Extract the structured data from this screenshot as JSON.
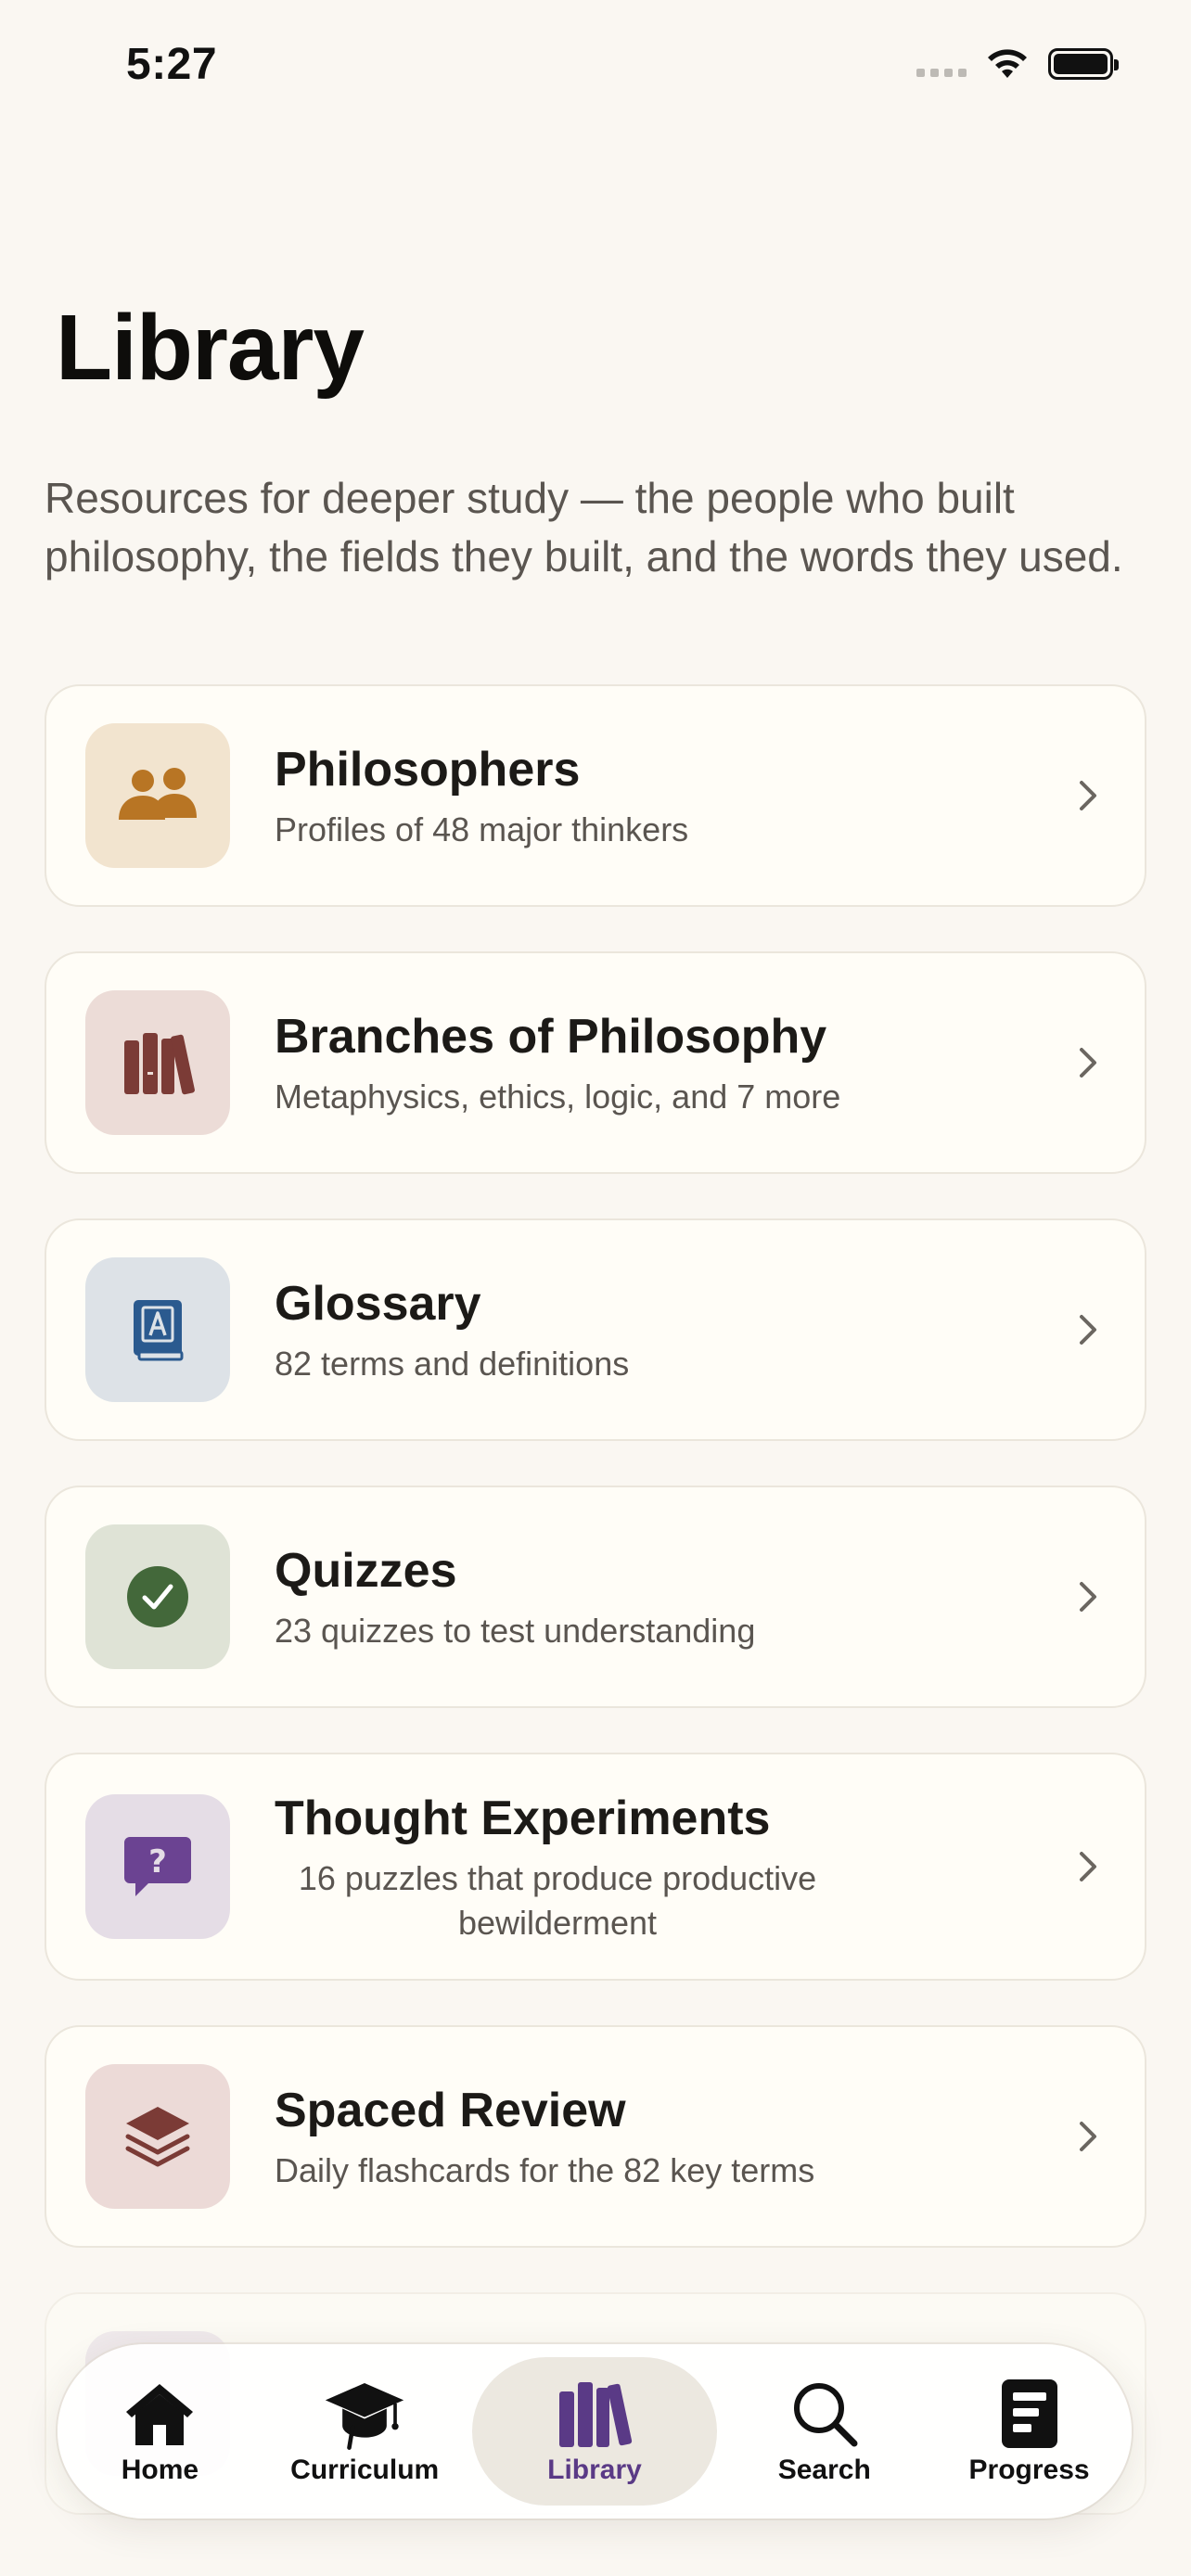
{
  "status": {
    "time": "5:27"
  },
  "page": {
    "title": "Library",
    "subtitle": "Resources for deeper study — the people who built philosophy, the fields they built, and the words they used."
  },
  "cards": [
    {
      "title": "Philosophers",
      "description": "Profiles of 48 major thinkers",
      "icon": "people-icon",
      "icon_bg": "#f2e4cf",
      "icon_color": "#b87524"
    },
    {
      "title": "Branches of Philosophy",
      "description": "Metaphysics, ethics, logic, and 7 more",
      "icon": "books-icon",
      "icon_bg": "#ecdcd7",
      "icon_color": "#7b3b36"
    },
    {
      "title": "Glossary",
      "description": "82 terms and definitions",
      "icon": "dictionary-icon",
      "icon_bg": "#dde2e7",
      "icon_color": "#2b5a8f"
    },
    {
      "title": "Quizzes",
      "description": "23 quizzes to test understanding",
      "icon": "checkmark-icon",
      "icon_bg": "#dfe3d6",
      "icon_color": "#43683a"
    },
    {
      "title": "Thought Experiments",
      "description": "16 puzzles that produce productive bewilderment",
      "icon": "question-bubble-icon",
      "icon_bg": "#e5dde6",
      "icon_color": "#6b4392"
    },
    {
      "title": "Spaced Review",
      "description": "Daily flashcards for the 82 key terms",
      "icon": "stack-icon",
      "icon_bg": "#ecdad7",
      "icon_color": "#7b3b36"
    }
  ],
  "tabs": [
    {
      "label": "Home",
      "icon": "home-icon"
    },
    {
      "label": "Curriculum",
      "icon": "graduation-cap-icon"
    },
    {
      "label": "Library",
      "icon": "books-icon",
      "active": true
    },
    {
      "label": "Search",
      "icon": "search-icon"
    },
    {
      "label": "Progress",
      "icon": "progress-icon"
    }
  ]
}
